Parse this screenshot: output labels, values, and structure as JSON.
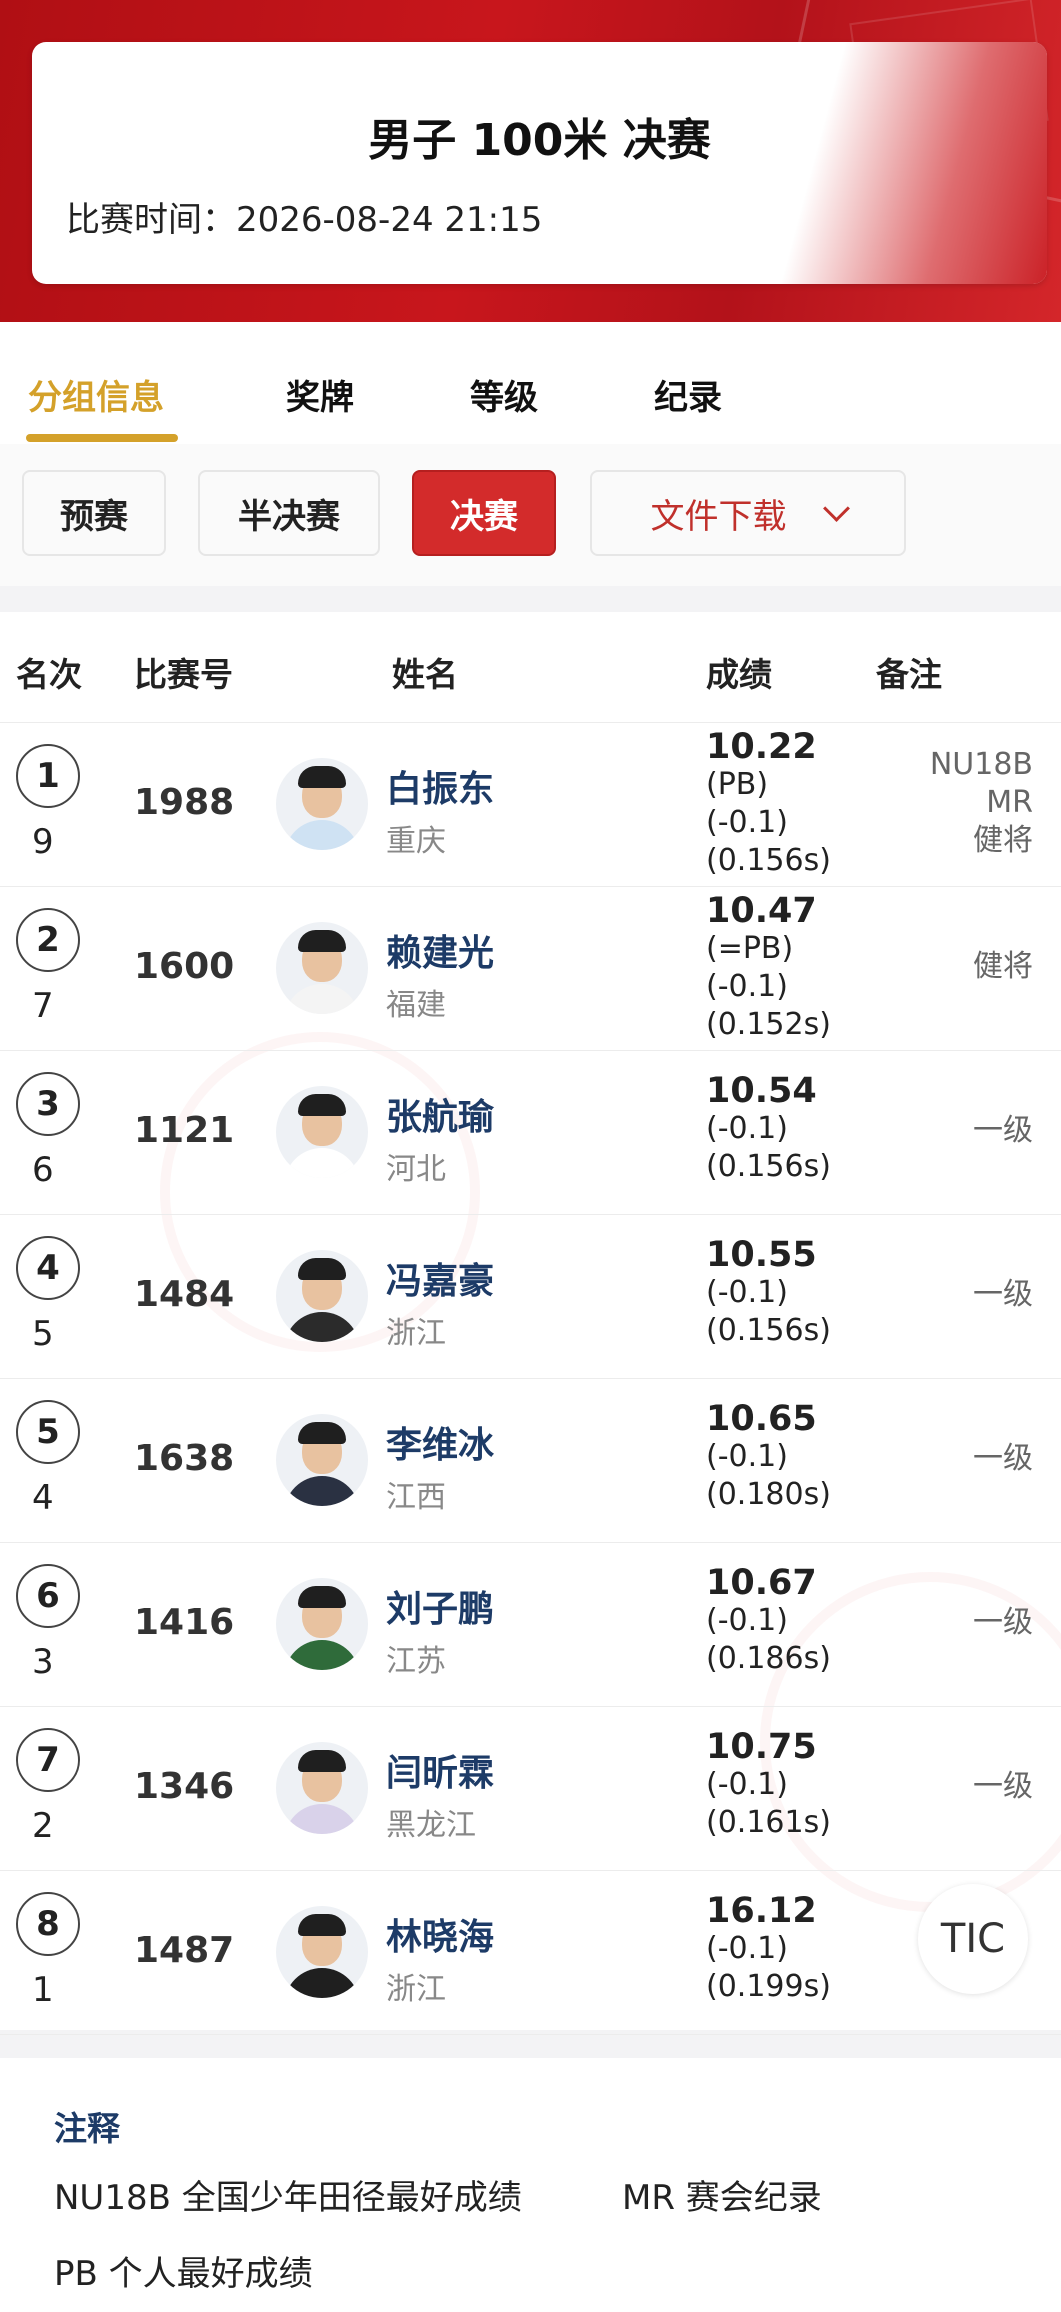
{
  "header": {
    "title": "男子 100米 决赛",
    "time_label": "比赛时间：",
    "time_value": "2026-08-24  21:15"
  },
  "tabs": [
    {
      "label": "分组信息",
      "active": true
    },
    {
      "label": "奖牌",
      "active": false
    },
    {
      "label": "等级",
      "active": false
    },
    {
      "label": "纪录",
      "active": false
    }
  ],
  "rounds": {
    "heats": "预赛",
    "semis": "半决赛",
    "final": "决赛",
    "download": "文件下载",
    "active": "决赛"
  },
  "table": {
    "headers": {
      "rank": "名次",
      "bib": "比赛号",
      "name": "姓名",
      "result": "成绩",
      "note": "备注"
    },
    "rows": [
      {
        "rank": "1",
        "lane": "9",
        "bib": "1988",
        "name": "白振东",
        "province": "重庆",
        "mark": "10.22",
        "pb": "(PB)",
        "wind": "(-0.1)",
        "reaction": "(0.156s)",
        "note_lines": [
          "NU18B",
          "MR",
          "健将"
        ]
      },
      {
        "rank": "2",
        "lane": "7",
        "bib": "1600",
        "name": "赖建光",
        "province": "福建",
        "mark": "10.47",
        "pb": "(=PB)",
        "wind": "(-0.1)",
        "reaction": "(0.152s)",
        "note_lines": [
          "健将"
        ]
      },
      {
        "rank": "3",
        "lane": "6",
        "bib": "1121",
        "name": "张航瑜",
        "province": "河北",
        "mark": "10.54",
        "pb": "",
        "wind": "(-0.1)",
        "reaction": "(0.156s)",
        "note_lines": [
          "一级"
        ]
      },
      {
        "rank": "4",
        "lane": "5",
        "bib": "1484",
        "name": "冯嘉豪",
        "province": "浙江",
        "mark": "10.55",
        "pb": "",
        "wind": "(-0.1)",
        "reaction": "(0.156s)",
        "note_lines": [
          "一级"
        ]
      },
      {
        "rank": "5",
        "lane": "4",
        "bib": "1638",
        "name": "李维冰",
        "province": "江西",
        "mark": "10.65",
        "pb": "",
        "wind": "(-0.1)",
        "reaction": "(0.180s)",
        "note_lines": [
          "一级"
        ]
      },
      {
        "rank": "6",
        "lane": "3",
        "bib": "1416",
        "name": "刘子鹏",
        "province": "江苏",
        "mark": "10.67",
        "pb": "",
        "wind": "(-0.1)",
        "reaction": "(0.186s)",
        "note_lines": [
          "一级"
        ]
      },
      {
        "rank": "7",
        "lane": "2",
        "bib": "1346",
        "name": "闫昕霖",
        "province": "黑龙江",
        "mark": "10.75",
        "pb": "",
        "wind": "(-0.1)",
        "reaction": "(0.161s)",
        "note_lines": [
          "一级"
        ]
      },
      {
        "rank": "8",
        "lane": "1",
        "bib": "1487",
        "name": "林晓海",
        "province": "浙江",
        "mark": "16.12",
        "pb": "",
        "wind": "(-0.1)",
        "reaction": "(0.199s)",
        "note_lines": [
          "TIC"
        ]
      }
    ]
  },
  "notes": {
    "title": "注释",
    "line1a": "NU18B 全国少年田径最好成绩",
    "line1b": "MR 赛会纪录",
    "line2": "PB 个人最好成绩"
  },
  "colors": {
    "brand_red": "#c8161c",
    "active_tab": "#d4a12a",
    "active_button": "#d32b2b",
    "name_blue": "#1d3b67"
  }
}
